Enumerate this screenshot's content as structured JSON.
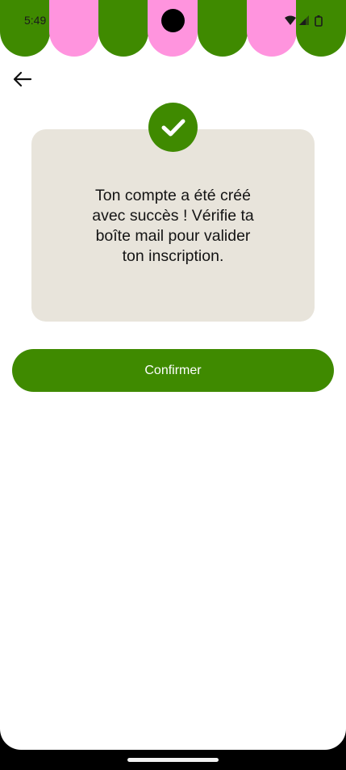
{
  "status_bar": {
    "time": "5:49",
    "icons": [
      "wifi-icon",
      "signal-icon",
      "battery-icon"
    ]
  },
  "header": {
    "back_icon": "arrow-left-icon",
    "awning_colors": [
      "#3f8a00",
      "#ff94de"
    ]
  },
  "card": {
    "check_icon": "checkmark-icon",
    "message_line1": "Ton compte a été créé",
    "message_line2": "avec succès ! Vérifie ta",
    "message_line3": "boîte mail pour valider",
    "message_line4": "ton inscription."
  },
  "actions": {
    "confirm_label": "Confirmer"
  },
  "colors": {
    "accent": "#3f8a00",
    "card_bg": "#e8e4db",
    "pink": "#ff94de"
  }
}
